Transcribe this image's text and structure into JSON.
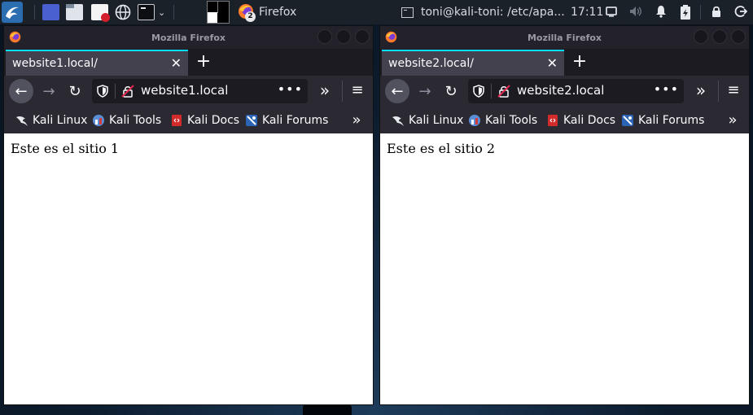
{
  "panel": {
    "taskbar_app": "Firefox",
    "taskbar_badge": "2",
    "terminal_title": "toni@kali-toni: /etc/apa...",
    "clock": "17:11"
  },
  "windows": [
    {
      "title": "Mozilla Firefox",
      "tab_label": "website1.local/",
      "url": "website1.local",
      "page_text": "Este es el sitio 1"
    },
    {
      "title": "Mozilla Firefox",
      "tab_label": "website2.local/",
      "url": "website2.local",
      "page_text": "Este es el sitio 2"
    }
  ],
  "bookmarks": [
    "Kali Linux",
    "Kali Tools",
    "Kali Docs",
    "Kali Forums"
  ],
  "icons": {
    "tab_close": "✕",
    "new_tab": "+",
    "back": "←",
    "forward": "→",
    "reload": "↻",
    "page_actions": "•••",
    "overflow": "»",
    "menu": "≡"
  },
  "colors": {
    "tab_accent": "#00ddff",
    "panel_bg": "#1b2129",
    "toolbar_bg": "#2b2a33",
    "page_bg": "#ffffff"
  }
}
